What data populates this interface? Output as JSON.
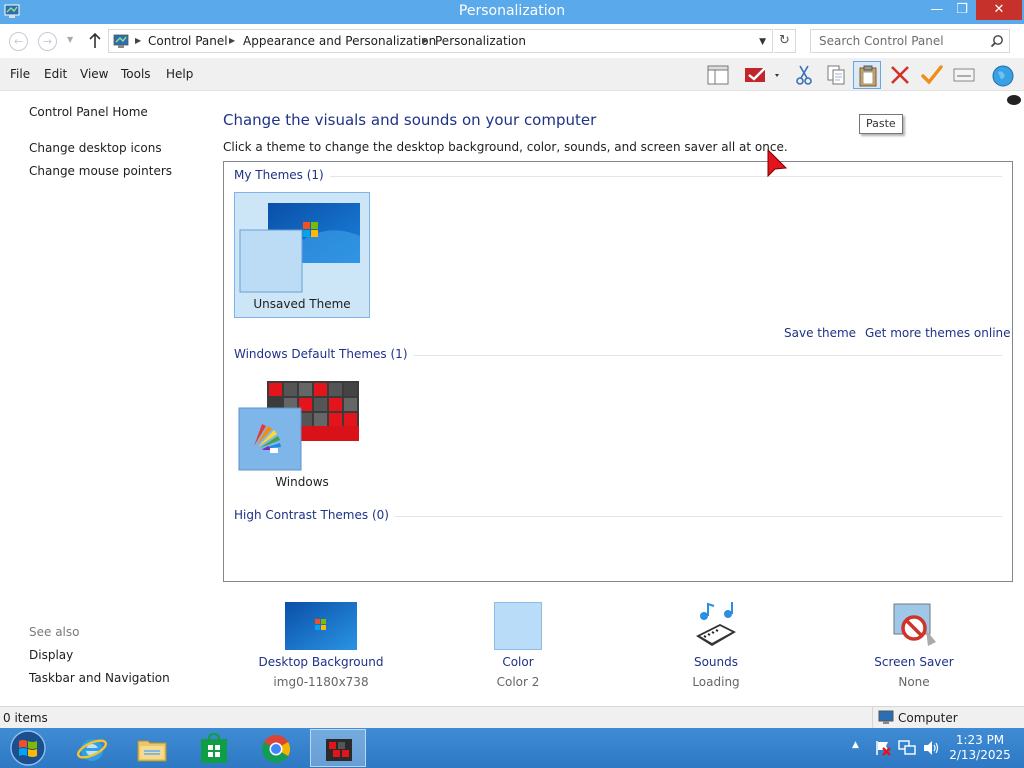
{
  "window": {
    "title": "Personalization"
  },
  "address": {
    "crumbs": [
      "Control Panel",
      "Appearance and Personalization",
      "Personalization"
    ],
    "search_placeholder": "Search Control Panel"
  },
  "menu": [
    "File",
    "Edit",
    "View",
    "Tools",
    "Help"
  ],
  "toolbar": {
    "icons": [
      "layout-icon",
      "checkmark-flag-icon",
      "cut-icon",
      "copy-icon",
      "paste-icon",
      "delete-icon",
      "checkmark-icon",
      "properties-icon",
      "globe-icon"
    ],
    "tooltip": "Paste"
  },
  "sidebar": {
    "home": "Control Panel Home",
    "links": [
      "Change desktop icons",
      "Change mouse pointers"
    ],
    "see_also_title": "See also",
    "see_also": [
      "Display",
      "Taskbar and Navigation"
    ]
  },
  "main": {
    "heading": "Change the visuals and sounds on your computer",
    "subheading": "Click a theme to change the desktop background, color, sounds, and screen saver all at once.",
    "groups": {
      "my_themes": "My Themes (1)",
      "default_themes": "Windows Default Themes (1)",
      "high_contrast": "High Contrast Themes (0)"
    },
    "themes": {
      "unsaved": "Unsaved Theme",
      "windows": "Windows"
    },
    "save_theme": "Save theme",
    "get_more": "Get more themes online"
  },
  "bottom": [
    {
      "label": "Desktop Background",
      "value": "img0-1180x738"
    },
    {
      "label": "Color",
      "value": "Color 2"
    },
    {
      "label": "Sounds",
      "value": "Loading"
    },
    {
      "label": "Screen Saver",
      "value": "None"
    }
  ],
  "status": {
    "items": "0 items",
    "location": "Computer"
  },
  "taskbar": {
    "time": "1:23 PM",
    "date": "2/13/2025",
    "colors": {
      "bar": "#3384cf",
      "accent": "#5aa9ea"
    }
  }
}
